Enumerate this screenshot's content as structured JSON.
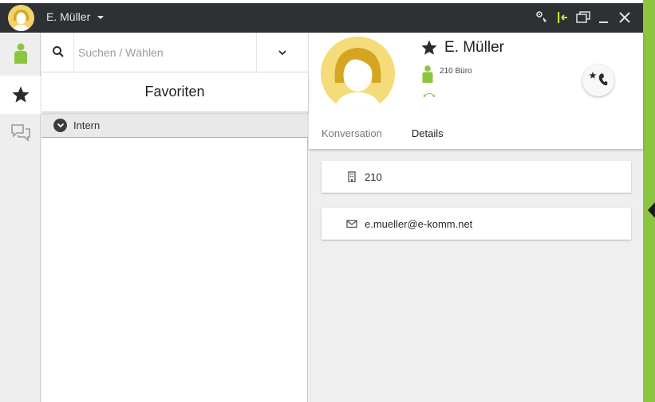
{
  "titlebar": {
    "user_name": "E. Müller",
    "icons": [
      "settings-phone-icon",
      "pin-icon",
      "window-mode-icon",
      "minimize-icon",
      "close-icon"
    ]
  },
  "rail": {
    "items": [
      {
        "name": "contacts",
        "icon": "person-icon",
        "active": false
      },
      {
        "name": "favorites",
        "icon": "star-icon",
        "active": true
      },
      {
        "name": "chats",
        "icon": "chat-icon",
        "active": false
      }
    ]
  },
  "search": {
    "placeholder": "Suchen / Wählen",
    "value": ""
  },
  "favorites": {
    "header": "Favoriten",
    "groups": [
      {
        "label": "Intern"
      }
    ]
  },
  "contact": {
    "name": "E. Müller",
    "extension_label": "210 Büro",
    "tabs": [
      {
        "label": "Konversation",
        "active": false
      },
      {
        "label": "Details",
        "active": true
      }
    ],
    "details": {
      "phone": "210",
      "email": "e.mueller@e-komm.net"
    }
  },
  "colors": {
    "accent_green": "#8cc63f",
    "titlebar": "#2e3133",
    "avatar_yellow": "#f2d36b"
  }
}
